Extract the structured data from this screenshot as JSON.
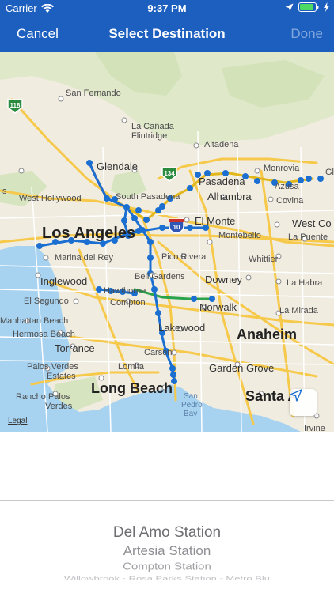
{
  "status_bar": {
    "carrier": "Carrier",
    "time": "9:37 PM"
  },
  "nav": {
    "cancel_label": "Cancel",
    "title": "Select Destination",
    "done_label": "Done"
  },
  "map": {
    "places": {
      "san_fernando": "San Fernando",
      "la_canada": "La Cañada",
      "flintridge": "Flintridge",
      "altadena": "Altadena",
      "glendale": "Glendale",
      "pasadena": "Pasadena",
      "monrovia": "Monrovia",
      "azusa": "Azusa",
      "gl": "Gl",
      "west_hollywood": "West Hollywood",
      "south_pasadena": "South Pasadena",
      "alhambra": "Alhambra",
      "covina": "Covina",
      "s_edge": "s",
      "los_angeles": "Los Angeles",
      "el_monte": "El Monte",
      "west_covina": "West Co",
      "marina_del_rey": "Marina del Rey",
      "montebello": "Montebello",
      "la_puente": "La Puente",
      "pico_rivera": "Pico Rivera",
      "whittier": "Whittier",
      "inglewood": "Inglewood",
      "bell_gardens": "Bell Gardens",
      "downey": "Downey",
      "la_habra": "La Habra",
      "el_segundo": "El Segundo",
      "hawthorne": "Hawthorne",
      "compton": "Compton",
      "norwalk": "Norwalk",
      "la_mirada": "La Mirada",
      "manhattan_beach": "Manhattan Beach",
      "hermosa_beach": "Hermosa Beach",
      "lakewood": "Lakewood",
      "anaheim": "Anaheim",
      "torrance": "Torrance",
      "carson": "Carson",
      "palos_verdes_estates_1": "Palos Verdes",
      "palos_verdes_estates_2": "Estates",
      "lomita": "Lomita",
      "garden_grove": "Garden Grove",
      "rancho_pv_1": "Rancho Palos",
      "rancho_pv_2": "Verdes",
      "long_beach": "Long Beach",
      "san_pedro_bay_1": "San",
      "san_pedro_bay_2": "Pedro",
      "san_pedro_bay_3": "Bay",
      "santa_ana": "Santa A",
      "irvine": "Irvine"
    },
    "shields": {
      "i118": "118",
      "r134": "134",
      "i10": "10"
    },
    "legal": "Legal",
    "colors": {
      "blue_line": "#1a6fd1",
      "red_line": "#d12a2a",
      "green_line": "#2aa34a",
      "gold_line": "#e2b71c",
      "water": "#a8d3f0"
    }
  },
  "picker": {
    "options": [
      "Del Amo Station",
      "Artesia Station",
      "Compton Station",
      "Willowbrook - Rosa Parks Station - Metro Blu"
    ]
  }
}
